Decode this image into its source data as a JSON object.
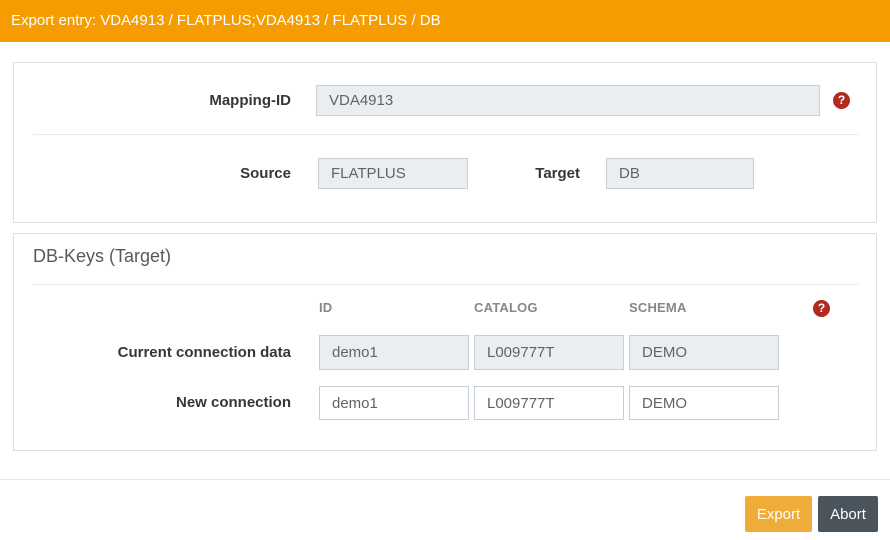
{
  "header": {
    "title": "Export entry: VDA4913 / FLATPLUS;VDA4913 / FLATPLUS / DB"
  },
  "form": {
    "mapping_id": {
      "label": "Mapping-ID",
      "value": "VDA4913"
    },
    "source": {
      "label": "Source",
      "value": "FLATPLUS"
    },
    "target": {
      "label": "Target",
      "value": "DB"
    },
    "help_icon_glyph": "?"
  },
  "db_keys": {
    "title": "DB-Keys (Target)",
    "columns": [
      "ID",
      "CATALOG",
      "SCHEMA"
    ],
    "help_icon_glyph": "?",
    "rows": [
      {
        "label": "Current connection data",
        "state": "readonly",
        "values": [
          "demo1",
          "L009777T",
          "DEMO"
        ]
      },
      {
        "label": "New connection",
        "state": "editable",
        "values": [
          "demo1",
          "L009777T",
          "DEMO"
        ]
      }
    ]
  },
  "footer": {
    "export_label": "Export",
    "abort_label": "Abort"
  },
  "colors": {
    "header_bg": "#F49C00",
    "export_button_bg": "#F0AC38",
    "abort_button_bg": "#4A545C",
    "help_icon_bg": "#B02A1E",
    "readonly_field_bg": "#EBEEF1",
    "panel_border": "#DCE1E6"
  }
}
